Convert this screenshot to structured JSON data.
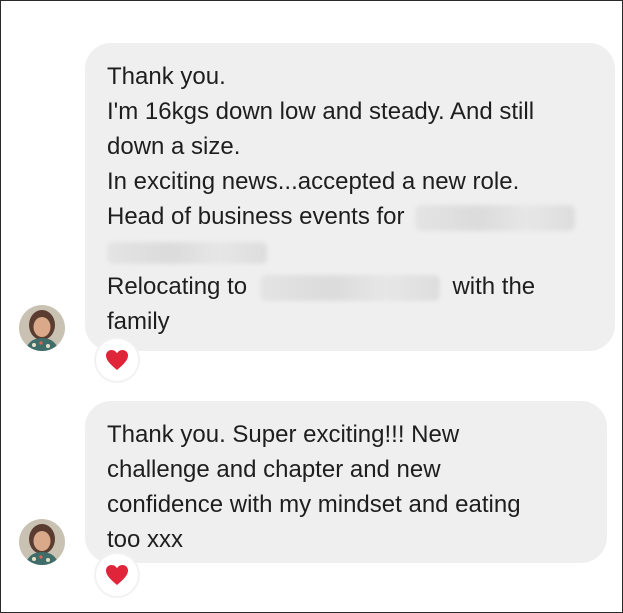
{
  "messages": [
    {
      "lines": [
        "Thank you.",
        "I'm 16kgs down low and steady. And still",
        "down a size.",
        "In exciting news...accepted a new role.",
        "Head of business events for",
        "Relocating to",
        "with the",
        "family"
      ],
      "reaction": "heart-icon"
    },
    {
      "lines": [
        "Thank you. Super exciting!!! New",
        "challenge and chapter and new",
        "confidence with my mindset and eating",
        "too xxx"
      ],
      "reaction": "heart-icon"
    }
  ],
  "colors": {
    "bubble": "#efefef",
    "text": "#1e1e1e",
    "heart": "#e0253a",
    "background": "#ffffff"
  }
}
